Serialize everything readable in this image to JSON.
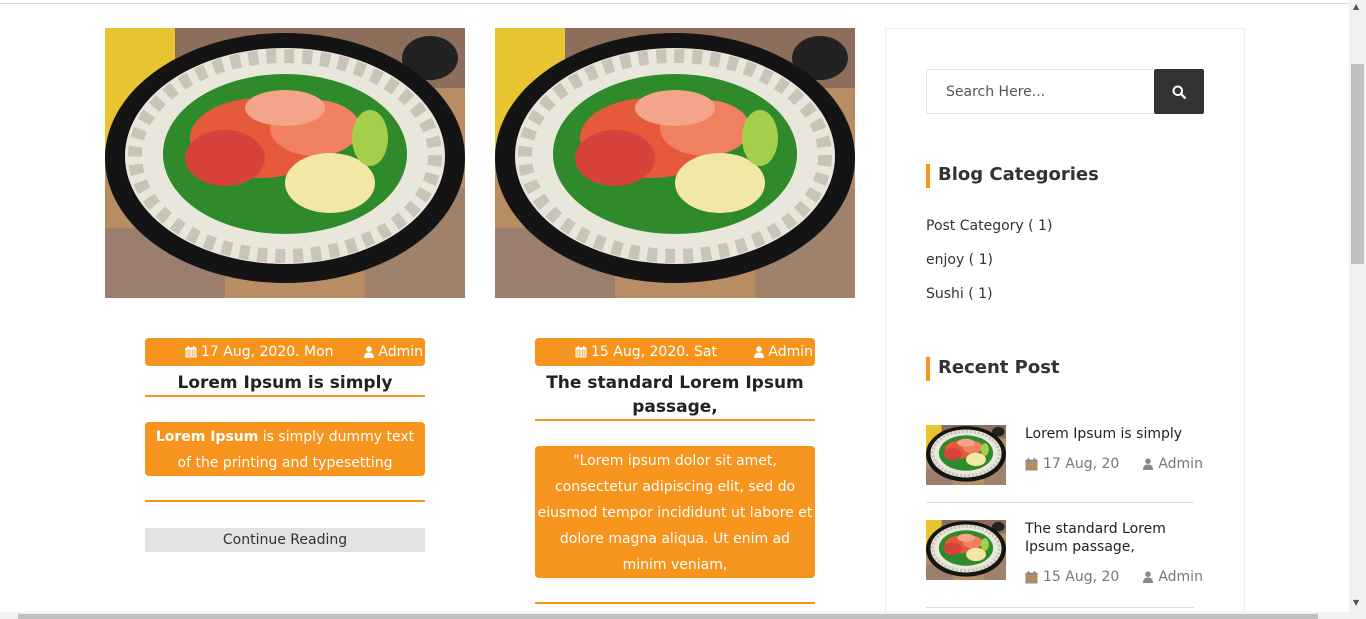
{
  "posts": [
    {
      "date": "17 Aug, 2020. Mon",
      "author": "Admin",
      "title": "Lorem Ipsum is simply",
      "excerpt_bold": "Lorem Ipsum",
      "excerpt_rest": " is simply dummy text of the printing and typesetting industry.",
      "continue_label": "Continue Reading"
    },
    {
      "date": "15 Aug, 2020. Sat",
      "author": "Admin",
      "title": "The standard Lorem Ipsum passage,",
      "excerpt": "\"Lorem ipsum dolor sit amet, consectetur adipiscing elit, sed do eiusmod tempor incididunt ut labore et dolore magna aliqua. Ut enim ad minim veniam,"
    }
  ],
  "sidebar": {
    "search_placeholder": "Search Here...",
    "categories_title": "Blog Categories",
    "categories": [
      "Post Category ( 1)",
      "enjoy ( 1)",
      "Sushi ( 1)"
    ],
    "recent_title": "Recent Post",
    "recent": [
      {
        "title": "Lorem Ipsum is simply",
        "date": "17 Aug, 20",
        "author": "Admin"
      },
      {
        "title": "The standard Lorem Ipsum passage,",
        "date": "15 Aug, 20",
        "author": "Admin"
      }
    ]
  },
  "colors": {
    "accent": "#f7941d",
    "dark": "#333333"
  },
  "icons": {
    "date": "calendar-icon",
    "author": "user-icon",
    "search": "search-icon"
  }
}
